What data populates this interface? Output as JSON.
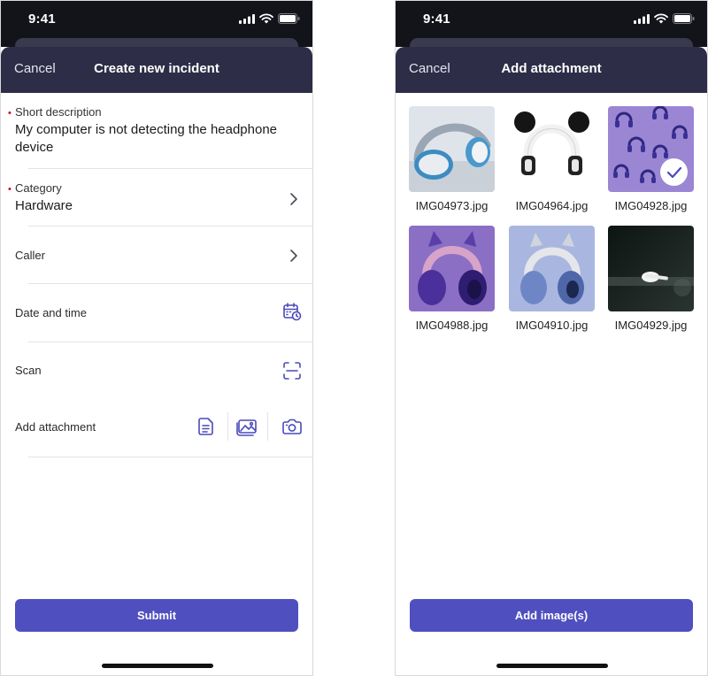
{
  "status": {
    "time": "9:41"
  },
  "incident_form": {
    "cancel_label": "Cancel",
    "title": "Create new incident",
    "fields": {
      "short_description": {
        "label": "Short description",
        "value": "My computer is not detecting the headphone device",
        "required": true
      },
      "category": {
        "label": "Category",
        "value": "Hardware",
        "required": true
      },
      "caller": {
        "label": "Caller"
      },
      "date_time": {
        "label": "Date and time"
      },
      "scan": {
        "label": "Scan"
      },
      "attachment": {
        "label": "Add attachment"
      }
    },
    "submit_label": "Submit"
  },
  "attachment_picker": {
    "cancel_label": "Cancel",
    "title": "Add attachment",
    "images": [
      {
        "filename": "IMG04973.jpg",
        "selected": false
      },
      {
        "filename": "IMG04964.jpg",
        "selected": false
      },
      {
        "filename": "IMG04928.jpg",
        "selected": true
      },
      {
        "filename": "IMG04988.jpg",
        "selected": false
      },
      {
        "filename": "IMG04910.jpg",
        "selected": false
      },
      {
        "filename": "IMG04929.jpg",
        "selected": false
      }
    ],
    "add_label": "Add image(s)"
  },
  "colors": {
    "header": "#2e2d48",
    "primary": "#4f4fbf",
    "icon": "#4a4aba",
    "required": "#d0021b"
  }
}
